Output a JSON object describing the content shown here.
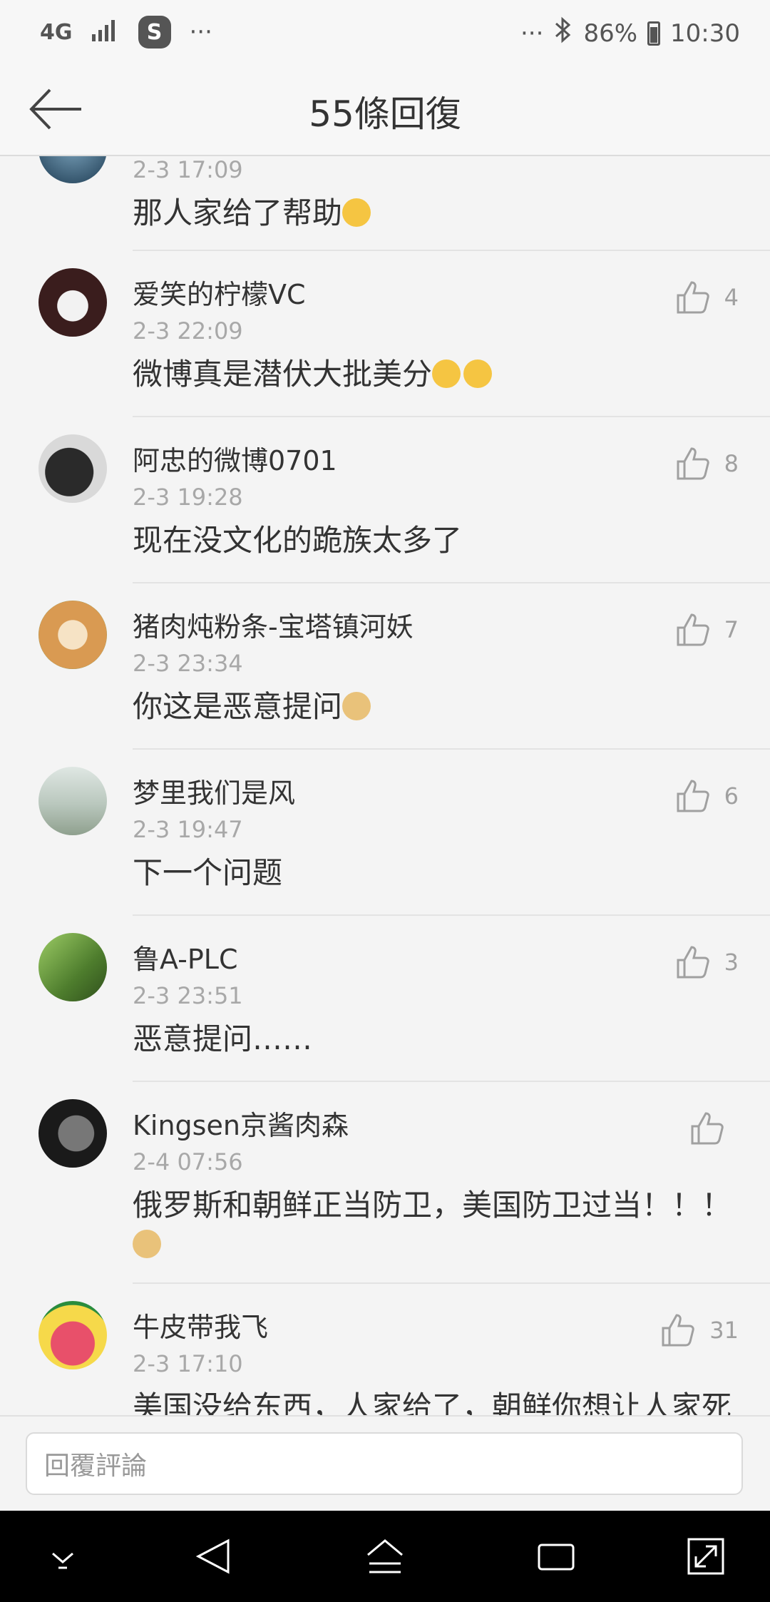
{
  "status_bar": {
    "network": "4G",
    "app_badge": "S",
    "dots_left": "···",
    "dots_right": "···",
    "battery": "86%",
    "time": "10:30"
  },
  "header": {
    "title": "55條回復"
  },
  "comments": [
    {
      "name": "",
      "time": "2-3 17:09",
      "text": "那人家给了帮助",
      "likes": ""
    },
    {
      "name": "爱笑的柠檬VC",
      "time": "2-3 22:09",
      "text": "微博真是潜伏大批美分",
      "likes": "4"
    },
    {
      "name": "阿忠的微博0701",
      "time": "2-3 19:28",
      "text": "现在没文化的跪族太多了",
      "likes": "8"
    },
    {
      "name": "猪肉炖粉条-宝塔镇河妖",
      "time": "2-3 23:34",
      "text": "你这是恶意提问",
      "likes": "7"
    },
    {
      "name": "梦里我们是风",
      "time": "2-3 19:47",
      "text": "下一个问题",
      "likes": "6"
    },
    {
      "name": "鲁A-PLC",
      "time": "2-3 23:51",
      "text": "恶意提问……",
      "likes": "3"
    },
    {
      "name": "Kingsen京酱肉森",
      "time": "2-4 07:56",
      "text": "俄罗斯和朝鲜正当防卫，美国防卫过当！！！",
      "likes": ""
    },
    {
      "name": "牛皮带我飞",
      "time": "2-3 17:10",
      "text": "美国没给东西，人家给了，朝鲜你想让人家死",
      "likes": "31"
    }
  ],
  "reply": {
    "placeholder": "回覆評論"
  },
  "colors": {
    "accent_text": "#333333",
    "muted_text": "#a8a8a8",
    "background": "#f4f4f4"
  },
  "icons": {
    "back": "arrow-left-icon",
    "like": "thumbs-up-icon",
    "nav": [
      "chevron-down-icon",
      "back-triangle-icon",
      "home-icon",
      "recents-icon",
      "expand-icon"
    ]
  }
}
